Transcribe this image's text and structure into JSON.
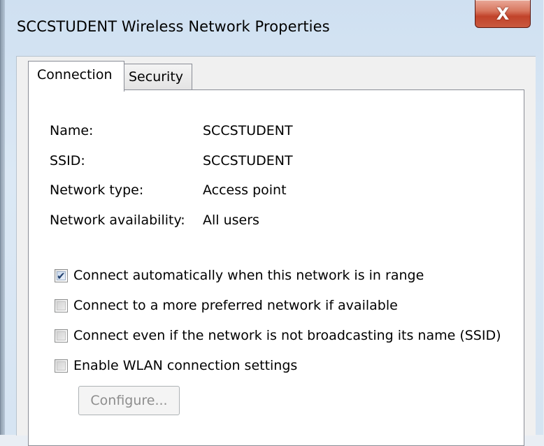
{
  "window": {
    "title": "SCCSTUDENT Wireless Network Properties",
    "close_glyph": "X"
  },
  "tabs": [
    {
      "label": "Connection",
      "selected": true
    },
    {
      "label": "Security",
      "selected": false
    }
  ],
  "properties": [
    {
      "label": "Name:",
      "value": "SCCSTUDENT"
    },
    {
      "label": "SSID:",
      "value": "SCCSTUDENT"
    },
    {
      "label": "Network type:",
      "value": "Access point"
    },
    {
      "label": "Network availability:",
      "value": "All users"
    }
  ],
  "options": [
    {
      "label": "Connect automatically when this network is in range",
      "checked": true
    },
    {
      "label": "Connect to a more preferred network if available",
      "checked": false
    },
    {
      "label": "Connect even if the network is not broadcasting its name (SSID)",
      "checked": false
    },
    {
      "label": "Enable WLAN connection settings",
      "checked": false
    }
  ],
  "configure_button": {
    "label": "Configure...",
    "enabled": false
  },
  "colors": {
    "title_bar": "#d6e4f2",
    "close_button": "#c9593f",
    "panel": "#ffffff",
    "disabled_text": "#8d8d8d"
  },
  "icons": {
    "close": "close-icon",
    "check": "checkmark-icon"
  }
}
